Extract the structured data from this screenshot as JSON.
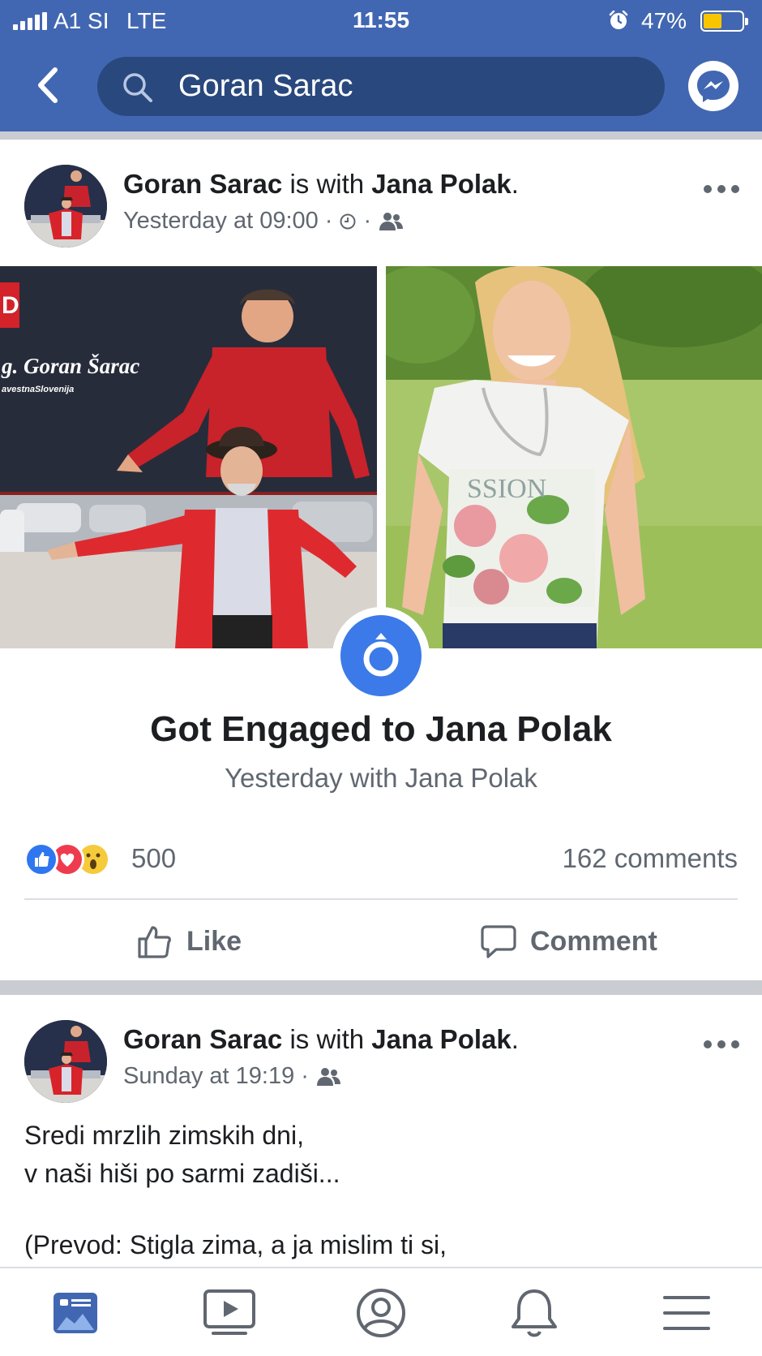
{
  "status_bar": {
    "carrier": "A1 SI",
    "network": "LTE",
    "time": "11:55",
    "battery": "47%",
    "battery_level": 0.47
  },
  "nav": {
    "back_icon": "chevron-left-icon",
    "search_icon": "search-icon",
    "search_value": "Goran Sarac",
    "messenger_icon": "messenger-icon"
  },
  "post1": {
    "author": "Goran Sarac",
    "with_text": "is with",
    "tagged": "Jana Polak",
    "period": ".",
    "timestamp": "Yesterday at 09:00",
    "dot": "·",
    "clock_icon": "clock-icon",
    "audience_icon": "friends-icon",
    "menu_icon": "more-icon",
    "life_event_icon": "engagement-ring-icon",
    "event_title": "Got Engaged to Jana Polak",
    "event_subtitle": "Yesterday with Jana Polak",
    "reaction_icons": [
      "like-icon",
      "love-icon",
      "wow-icon"
    ],
    "reaction_count": "500",
    "comment_count": "162 comments",
    "like_label": "Like",
    "comment_label": "Comment"
  },
  "post2": {
    "author": "Goran Sarac",
    "with_text": "is with",
    "tagged": "Jana Polak",
    "period": ".",
    "timestamp": "Sunday at 19:19",
    "dot": "·",
    "audience_icon": "friends-icon",
    "menu_icon": "more-icon",
    "line1": "Sredi mrzlih zimskih dni,",
    "line2": "v naši hiši po sarmi zadiši...",
    "line3": "(Prevod: Stigla zima, a ja mislim ti si,"
  },
  "tabbar": {
    "items": [
      "news-feed-icon",
      "watch-icon",
      "profile-icon",
      "notifications-icon",
      "menu-icon"
    ]
  },
  "colors": {
    "brand": "#4267b2",
    "search_bg": "#29487d",
    "ring_blue": "#3b7ae8",
    "battery": "#f7c600"
  }
}
